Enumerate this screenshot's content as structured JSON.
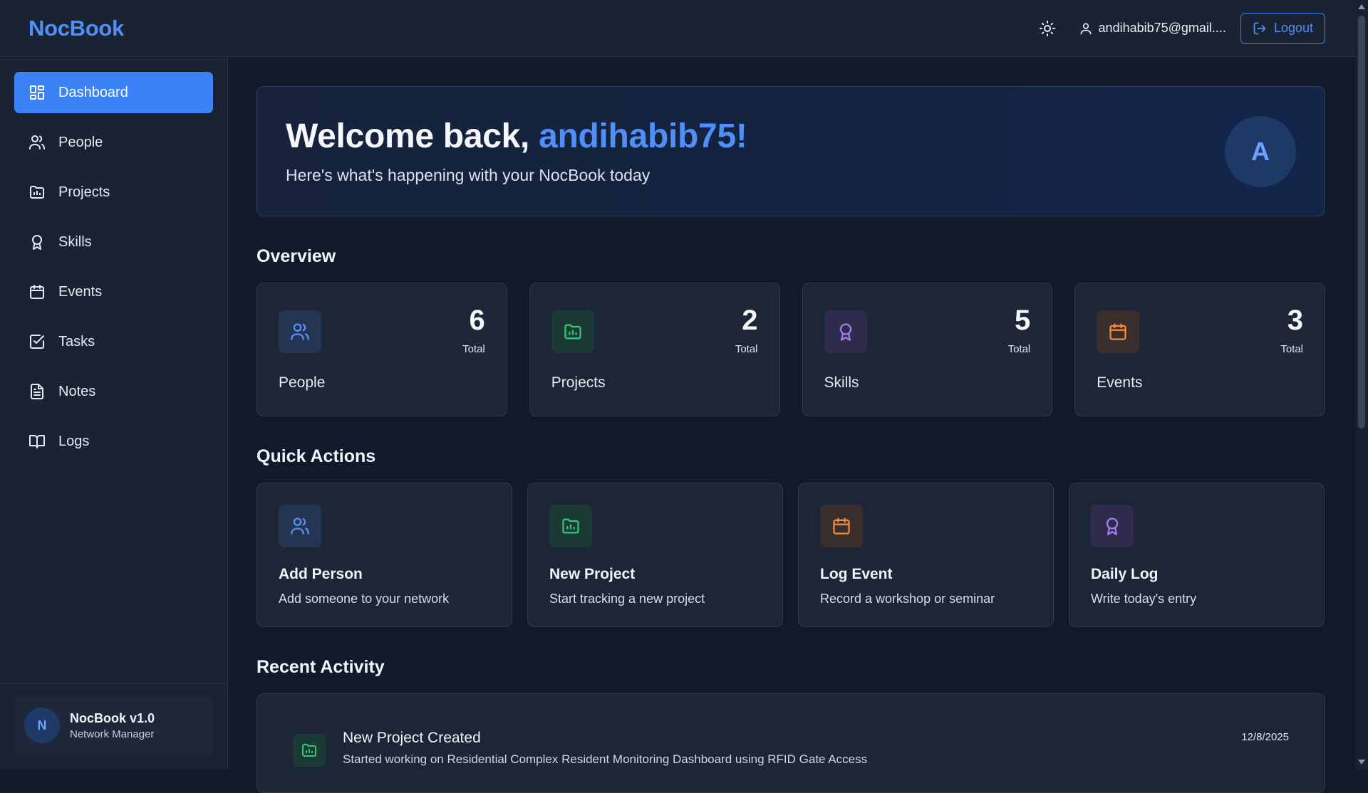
{
  "app": {
    "brand": "NocBook"
  },
  "header": {
    "user_email": "andihabib75@gmail....",
    "logout_label": "Logout"
  },
  "sidebar": {
    "items": [
      {
        "label": "Dashboard",
        "icon": "dashboard-icon",
        "active": true
      },
      {
        "label": "People",
        "icon": "people-icon"
      },
      {
        "label": "Projects",
        "icon": "folder-chart-icon"
      },
      {
        "label": "Skills",
        "icon": "award-icon"
      },
      {
        "label": "Events",
        "icon": "calendar-icon"
      },
      {
        "label": "Tasks",
        "icon": "check-square-icon"
      },
      {
        "label": "Notes",
        "icon": "file-text-icon"
      },
      {
        "label": "Logs",
        "icon": "book-open-icon"
      }
    ],
    "footer": {
      "avatar_letter": "N",
      "title": "NocBook v1.0",
      "subtitle": "Network Manager"
    }
  },
  "welcome": {
    "greeting": "Welcome back, ",
    "username": "andihabib75!",
    "subtitle": "Here's what's happening with your NocBook today",
    "avatar_letter": "A"
  },
  "overview": {
    "title": "Overview",
    "stats": [
      {
        "label": "People",
        "value": "6",
        "unit": "Total",
        "color": "#5b8ff5"
      },
      {
        "label": "Projects",
        "value": "2",
        "unit": "Total",
        "color": "#34c47a"
      },
      {
        "label": "Skills",
        "value": "5",
        "unit": "Total",
        "color": "#a77bf0"
      },
      {
        "label": "Events",
        "value": "3",
        "unit": "Total",
        "color": "#f08a3a"
      }
    ]
  },
  "quick_actions": {
    "title": "Quick Actions",
    "items": [
      {
        "title": "Add Person",
        "desc": "Add someone to your network"
      },
      {
        "title": "New Project",
        "desc": "Start tracking a new project"
      },
      {
        "title": "Log Event",
        "desc": "Record a workshop or seminar"
      },
      {
        "title": "Daily Log",
        "desc": "Write today's entry"
      }
    ]
  },
  "recent_activity": {
    "title": "Recent Activity",
    "items": [
      {
        "title": "New Project Created",
        "desc": "Started working on Residential Complex Resident Monitoring Dashboard using RFID Gate Access",
        "date": "12/8/2025"
      }
    ]
  }
}
